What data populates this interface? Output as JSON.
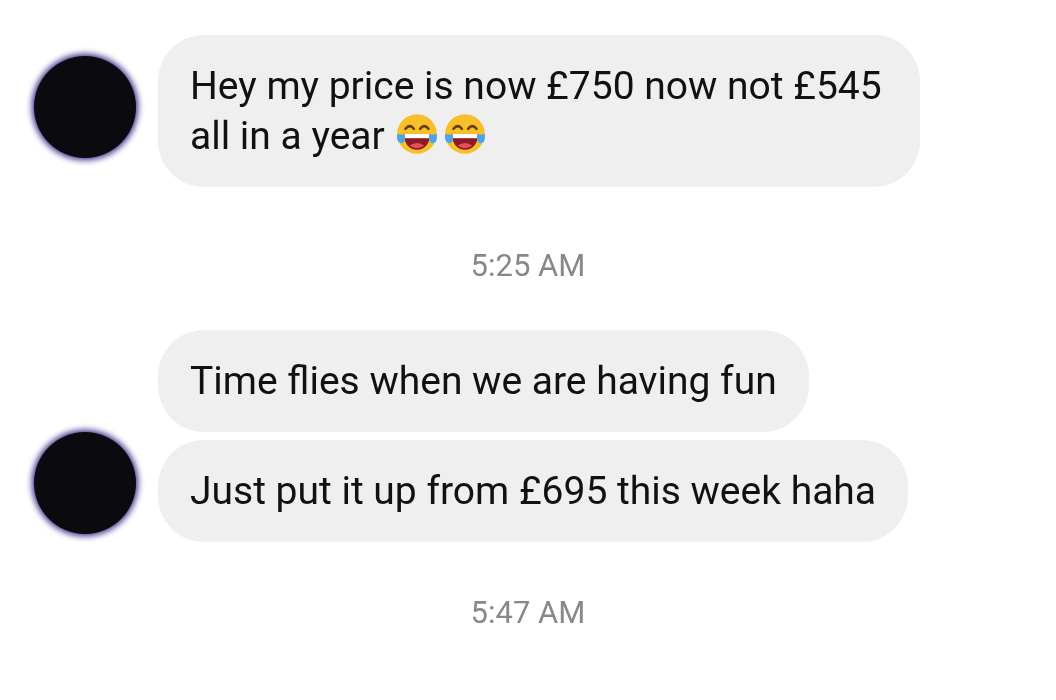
{
  "items": [
    {
      "kind": "group",
      "messages": [
        {
          "text": "Hey my price is now £750 now not £545 all in a year",
          "icons": [
            {
              "kind": "laughing-tears"
            },
            {
              "kind": "laughing-tears"
            }
          ]
        }
      ]
    },
    {
      "kind": "timestamp",
      "text": "5:25 AM"
    },
    {
      "kind": "group",
      "messages": [
        {
          "text": "Time flies when we are having fun"
        },
        {
          "text": "Just put it up from £695 this week haha"
        }
      ]
    },
    {
      "kind": "timestamp",
      "text": "5:47 AM"
    }
  ]
}
